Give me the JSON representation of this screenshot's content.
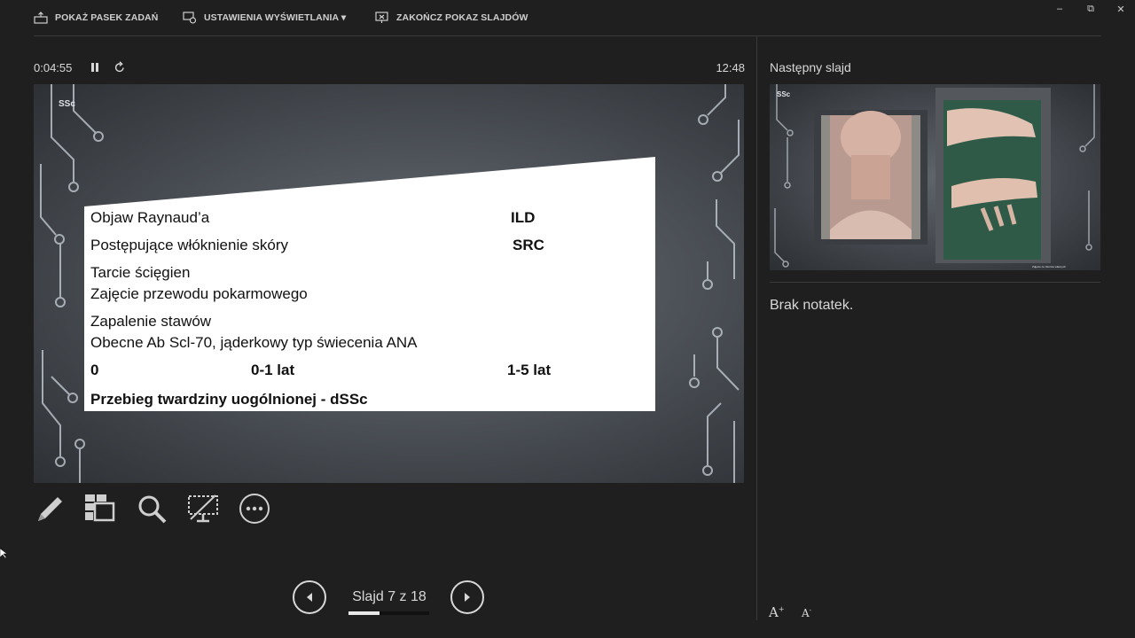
{
  "topbar": {
    "taskbar_label": "POKAŻ PASEK ZADAŃ",
    "display_settings_label": "USTAWIENIA WYŚWIETLANIA ▾",
    "end_show_label": "ZAKOŃCZ POKAZ SLAJDÓW"
  },
  "window_controls": {
    "minimize": "–",
    "restore": "⧉",
    "close": "✕"
  },
  "timer": {
    "elapsed": "0:04:55",
    "clock": "12:48"
  },
  "slide": {
    "tag": "SSc",
    "rows": [
      {
        "left": "Objaw Raynaud’a",
        "right": "ILD"
      },
      {
        "left": "Postępujące włóknienie skóry",
        "right": "SRC"
      }
    ],
    "lines": [
      "Tarcie ścięgien",
      "Zajęcie przewodu pokarmowego",
      "Zapalenie stawów",
      "Obecne Ab Scl-70, jąderkowy typ świecenia ANA"
    ],
    "timeline": [
      "0",
      "0-1 lat",
      "1-5 lat"
    ],
    "footer": "Przebieg twardziny uogólnionej - dSSc"
  },
  "tools": [
    "pen-tool",
    "see-all-slides",
    "zoom-into-slide",
    "black-screen",
    "more-options"
  ],
  "navigation": {
    "counter": "Slajd 7 z 18",
    "current": 7,
    "total": 18
  },
  "next": {
    "label": "Następny slajd",
    "tag": "SSc",
    "caption": "Zdjęcie ze zbiorów własnych"
  },
  "notes": {
    "text": "Brak notatek."
  },
  "font_controls": {
    "larger": "A",
    "smaller": "A"
  }
}
